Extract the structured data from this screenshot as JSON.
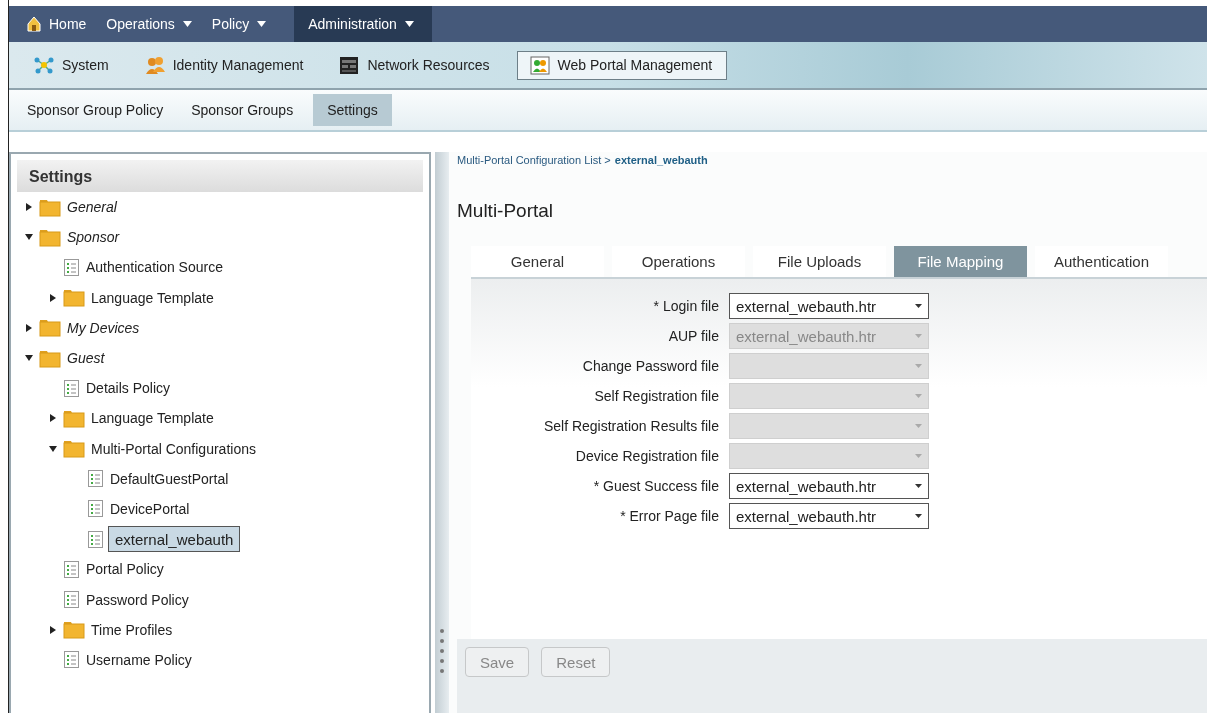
{
  "top_nav": [
    {
      "label": "Home",
      "selected": false,
      "has_menu": false,
      "kind": "home"
    },
    {
      "label": "Operations",
      "selected": false,
      "has_menu": true,
      "kind": "menu"
    },
    {
      "label": "Policy",
      "selected": false,
      "has_menu": true,
      "kind": "menu"
    },
    {
      "label": "Administration",
      "selected": true,
      "has_menu": true,
      "kind": "menu"
    }
  ],
  "section_tabs": [
    {
      "label": "System",
      "selected": false
    },
    {
      "label": "Identity Management",
      "selected": false
    },
    {
      "label": "Network Resources",
      "selected": false
    },
    {
      "label": "Web Portal Management",
      "selected": true
    }
  ],
  "sub_nav": [
    {
      "label": "Sponsor Group Policy",
      "selected": false
    },
    {
      "label": "Sponsor Groups",
      "selected": false
    },
    {
      "label": "Settings",
      "selected": true
    }
  ],
  "sidebar": {
    "title": "Settings",
    "items": [
      {
        "label": "General",
        "kind": "folder",
        "expanded": false,
        "selected": false
      },
      {
        "label": "Sponsor",
        "kind": "folder",
        "expanded": true,
        "selected": false,
        "children": [
          {
            "label": "Authentication Source",
            "kind": "page",
            "selected": false
          },
          {
            "label": "Language Template",
            "kind": "folder",
            "expanded": false,
            "selected": false
          }
        ]
      },
      {
        "label": "My Devices",
        "kind": "folder",
        "expanded": false,
        "selected": false
      },
      {
        "label": "Guest",
        "kind": "folder",
        "expanded": true,
        "selected": false,
        "children": [
          {
            "label": "Details Policy",
            "kind": "page",
            "selected": false
          },
          {
            "label": "Language Template",
            "kind": "folder",
            "expanded": false,
            "selected": false
          },
          {
            "label": "Multi-Portal Configurations",
            "kind": "folder",
            "expanded": true,
            "selected": false,
            "children": [
              {
                "label": "DefaultGuestPortal",
                "kind": "page",
                "selected": false
              },
              {
                "label": "DevicePortal",
                "kind": "page",
                "selected": false
              },
              {
                "label": "external_webauth",
                "kind": "page",
                "selected": true
              }
            ]
          },
          {
            "label": "Portal Policy",
            "kind": "page",
            "selected": false
          },
          {
            "label": "Password Policy",
            "kind": "page",
            "selected": false
          },
          {
            "label": "Time Profiles",
            "kind": "folder",
            "expanded": false,
            "selected": false
          },
          {
            "label": "Username Policy",
            "kind": "page",
            "selected": false
          }
        ]
      }
    ]
  },
  "breadcrumb": {
    "parent": "Multi-Portal Configuration List >",
    "current": "external_webauth"
  },
  "page_title": "Multi-Portal",
  "tabs": [
    {
      "label": "General",
      "selected": false
    },
    {
      "label": "Operations",
      "selected": false
    },
    {
      "label": "File Uploads",
      "selected": false
    },
    {
      "label": "File Mapping",
      "selected": true
    },
    {
      "label": "Authentication",
      "selected": false
    }
  ],
  "fields": [
    {
      "label": "* Login file",
      "value": "external_webauth.htr",
      "disabled": false
    },
    {
      "label": "AUP file",
      "value": "external_webauth.htr",
      "disabled": true
    },
    {
      "label": "Change Password file",
      "disabled": true
    },
    {
      "label": "Self Registration file",
      "disabled": true
    },
    {
      "label": "Self Registration Results file",
      "disabled": true
    },
    {
      "label": "Device Registration file",
      "disabled": true
    },
    {
      "label": "* Guest Success file",
      "value": "external_webauth.htr",
      "disabled": false
    },
    {
      "label": "* Error Page file",
      "value": "external_webauth.htr",
      "disabled": false
    }
  ],
  "buttons": [
    {
      "label": "Save",
      "disabled": true
    },
    {
      "label": "Reset",
      "disabled": true
    }
  ]
}
